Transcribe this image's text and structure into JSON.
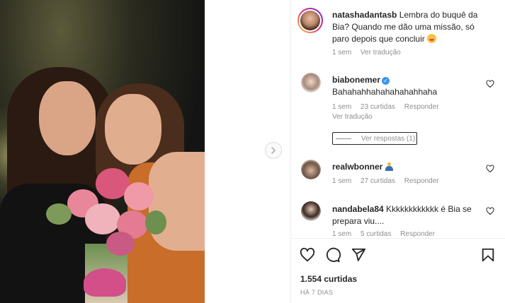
{
  "post": {
    "image_alt": "photo"
  },
  "comments": [
    {
      "username": "natashadantasb",
      "text": "Lembra do buquê da Bia? Quando me dão uma missão, só paro depois que concluir",
      "time": "1 sem",
      "translate": "Ver tradução"
    },
    {
      "username": "biabonemer",
      "text": "Bahahahhahahahahahhaha",
      "time": "1 sem",
      "likes": "23 curtidas",
      "reply": "Responder",
      "translate": "Ver tradução",
      "view_replies": "Ver respostas (1)"
    },
    {
      "username": "realwbonner",
      "time": "1 sem",
      "likes": "27 curtidas",
      "reply": "Responder"
    },
    {
      "username": "nandabela84",
      "text": "Kkkkkkkkkkkk é Bia se prepara viu....",
      "time": "1 sem",
      "likes": "5 curtidas",
      "reply": "Responder"
    }
  ],
  "footer": {
    "likes": "1.554 curtidas",
    "date": "HÁ 7 DIAS"
  },
  "icons": {
    "like": "heart-icon",
    "comment": "comment-icon",
    "share": "share-icon",
    "save": "bookmark-icon",
    "next": "chevron-right-icon"
  },
  "colors": {
    "text": "#262626",
    "muted": "#8e8e8e",
    "verified": "#3897f0"
  }
}
